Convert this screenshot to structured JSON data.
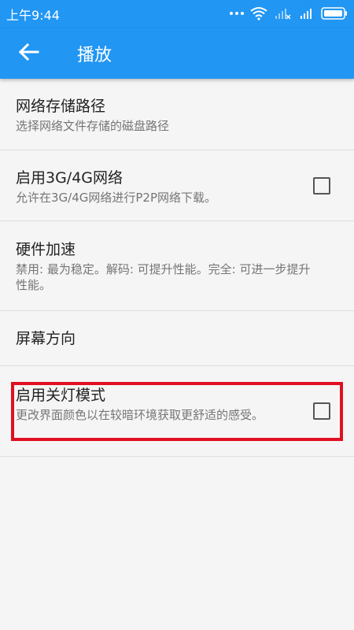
{
  "status_bar": {
    "time": "上午9:44"
  },
  "app_bar": {
    "title": "播放",
    "back_icon": "arrow-left-icon"
  },
  "settings": [
    {
      "title": "网络存储路径",
      "summary": "选择网络文件存储的磁盘路径"
    },
    {
      "title": "启用3G/4G网络",
      "summary": "允许在3G/4G网络进行P2P网络下载。",
      "checked": false
    },
    {
      "title": "硬件加速",
      "summary": "禁用: 最为稳定。解码: 可提升性能。完全: 可进一步提升性能。"
    },
    {
      "title": "屏幕方向"
    },
    {
      "title": "启用关灯模式",
      "summary": "更改界面颜色以在较暗环境获取更舒适的感受。",
      "checked": false,
      "highlighted": true
    }
  ],
  "colors": {
    "primary": "#2196f3",
    "highlight": "#e01020",
    "background": "#f5f5f5"
  }
}
